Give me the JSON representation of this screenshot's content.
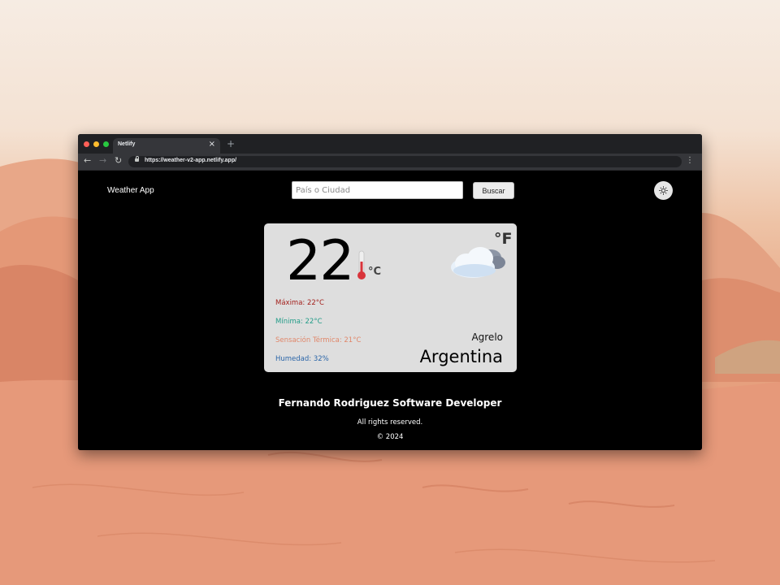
{
  "browser": {
    "tab_title": "Netlify",
    "tab_close": "×",
    "new_tab": "+",
    "url": "https://weather-v2-app.netlify.app/",
    "back": "←",
    "forward": "→",
    "reload": "↻",
    "menu": "⋮"
  },
  "header": {
    "brand": "Weather App",
    "search_placeholder": "País o Ciudad",
    "search_value": "",
    "search_button": "Buscar",
    "theme_icon": "sun-icon"
  },
  "weather": {
    "temperature": "22",
    "unit_celsius": "°C",
    "unit_fahrenheit": "°F",
    "condition_icon": "cloud-icon",
    "thermometer_icon": "thermometer-icon",
    "max": "Máxima: 22°C",
    "min": "Mínima: 22°C",
    "feels_like": "Sensación Térmica: 21°C",
    "humidity": "Humedad: 32%",
    "city": "Agrelo",
    "country": "Argentina",
    "colors": {
      "max": "#a3201c",
      "min": "#229c88",
      "feels_like": "#e0876a",
      "humidity": "#2a65a8",
      "card_bg": "#dedede"
    }
  },
  "footer": {
    "title": "Fernando Rodriguez Software Developer",
    "rights": "All rights reserved.",
    "copyright": "© 2024"
  }
}
